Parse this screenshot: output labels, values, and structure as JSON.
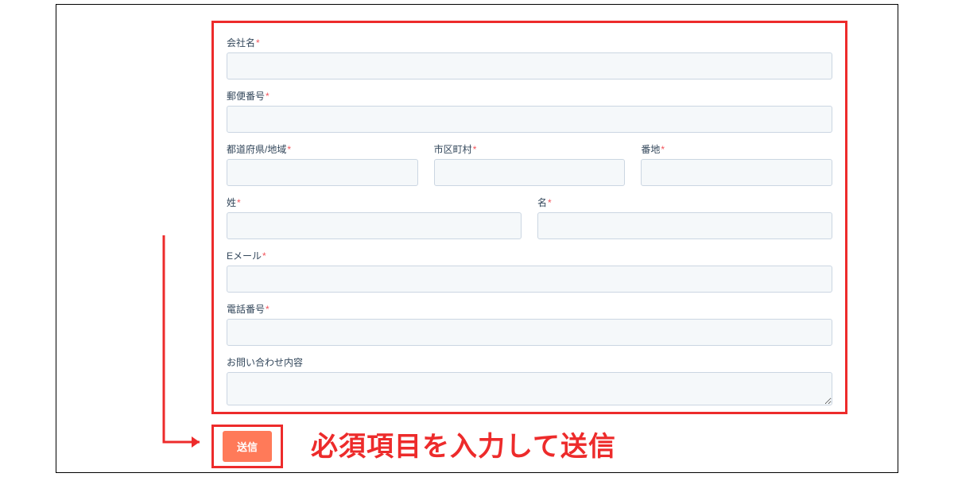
{
  "form": {
    "company_label": "会社名",
    "postal_label": "郵便番号",
    "prefecture_label": "都道府県/地域",
    "city_label": "市区町村",
    "street_label": "番地",
    "lastname_label": "姓",
    "firstname_label": "名",
    "email_label": "Eメール",
    "phone_label": "電話番号",
    "inquiry_label": "お問い合わせ内容",
    "required_mark": "*",
    "submit_label": "送信"
  },
  "instruction": "必須項目を入力して送信"
}
